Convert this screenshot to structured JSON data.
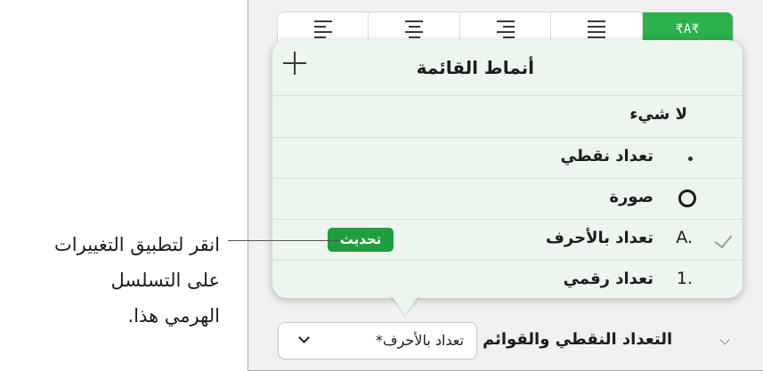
{
  "alignment_bar": {
    "buttons": [
      {
        "name": "align-right",
        "icon": "align-right-icon",
        "active": false
      },
      {
        "name": "align-center",
        "icon": "align-center-icon",
        "active": false
      },
      {
        "name": "align-left",
        "icon": "align-left-icon",
        "active": false
      },
      {
        "name": "justify",
        "icon": "justify-icon",
        "active": false
      },
      {
        "name": "text-direction",
        "icon": "text-direction-icon",
        "label": "₹A₹",
        "active": true
      }
    ],
    "active_color": "#2bb24c"
  },
  "popover": {
    "title": "أنماط القائمة",
    "rows": [
      {
        "label": "لا شيء",
        "marker": ""
      },
      {
        "label": "تعداد نقطي",
        "marker": "•"
      },
      {
        "label": "صورة",
        "marker": "circle"
      },
      {
        "label": "تعداد بالأحرف",
        "marker": "A.",
        "checked": true,
        "update_label": "تحديث"
      },
      {
        "label": "تعداد رقمي",
        "marker": "1."
      }
    ]
  },
  "footer": {
    "section_title": "التعداد النقطي والقوائم",
    "style_select_value": "تعداد بالأحرف*"
  },
  "callout": {
    "lines": [
      "انقر لتطبيق التغييرات",
      "على التسلسل",
      "الهرمي هذا."
    ]
  },
  "colors": {
    "accent": "#2bb24c",
    "update_button": "#1f9e3f",
    "popover_bg": "#ecf5ee"
  }
}
